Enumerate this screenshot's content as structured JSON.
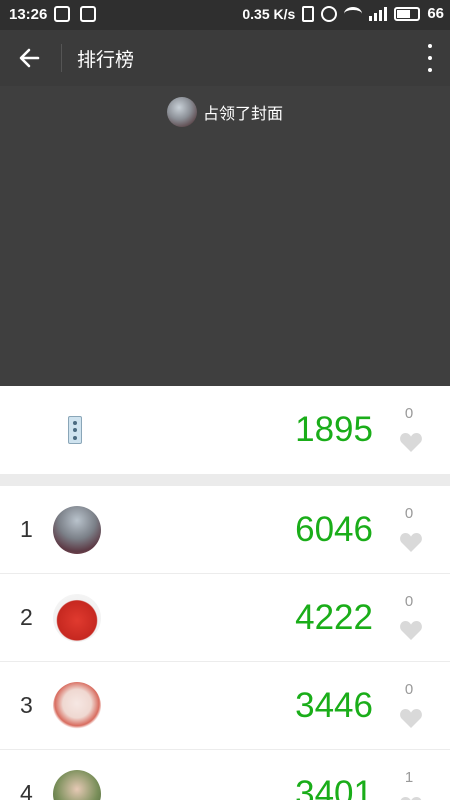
{
  "status_bar": {
    "time": "13:26",
    "network_speed": "0.35 K/s",
    "battery": "66"
  },
  "header": {
    "title": "排行榜"
  },
  "cover": {
    "text": "占领了封面"
  },
  "my_entry": {
    "steps": "1895",
    "likes": "0"
  },
  "ranking": [
    {
      "rank": "1",
      "steps": "6046",
      "likes": "0"
    },
    {
      "rank": "2",
      "steps": "4222",
      "likes": "0"
    },
    {
      "rank": "3",
      "steps": "3446",
      "likes": "0"
    },
    {
      "rank": "4",
      "steps": "3401",
      "likes": "1"
    }
  ],
  "colors": {
    "steps_green": "#1aad19",
    "appbar": "#3b3b3b",
    "cover": "#3f3f3f"
  }
}
